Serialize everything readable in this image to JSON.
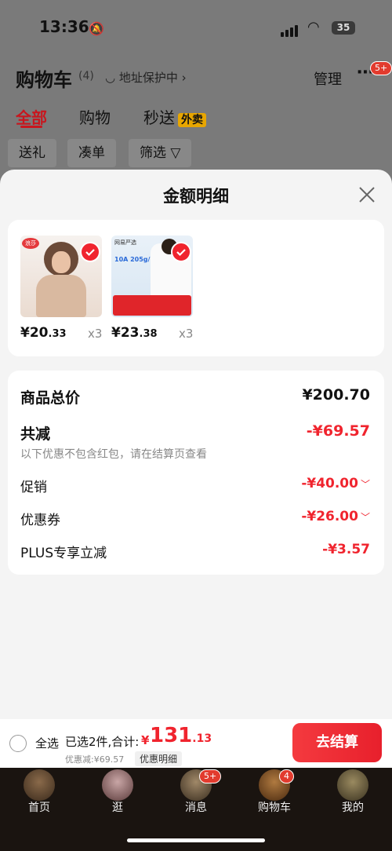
{
  "status_bar": {
    "time": "13:36",
    "battery": "35"
  },
  "background": {
    "title": "购物车",
    "count": "(4)",
    "address": "地址保护中",
    "manage": "管理",
    "more_badge": "5+",
    "tabs": [
      "全部",
      "购物",
      "秒送"
    ],
    "waimai": "外卖",
    "filters": [
      "送礼",
      "凑单",
      "筛选"
    ]
  },
  "sheet": {
    "title": "金额明细",
    "products": [
      {
        "brand": "浪莎",
        "price_int": "¥20",
        "price_dec": ".33",
        "qty": "x3"
      },
      {
        "brand": "网易严选",
        "price_int": "¥23",
        "price_dec": ".38",
        "qty": "x3"
      }
    ],
    "summary": {
      "total_label": "商品总价",
      "total_value": "¥200.70",
      "reduce_label": "共减",
      "reduce_value": "-¥69.57",
      "note": "以下优惠不包含红包，请在结算页查看",
      "promo_label": "促销",
      "promo_value": "-¥40.00",
      "coupon_label": "优惠券",
      "coupon_value": "-¥26.00",
      "plus_label": "PLUS专享立减",
      "plus_value": "-¥3.57"
    }
  },
  "checkout": {
    "select_all": "全选",
    "selected": "已选2件,合计:",
    "currency": "¥",
    "amount_int": "131",
    "amount_dec": ".13",
    "discount": "优惠减:¥69.57",
    "detail": "优惠明细",
    "pay": "去结算"
  },
  "tabbar": {
    "items": [
      "首页",
      "逛",
      "消息",
      "购物车",
      "我的"
    ],
    "message_badge": "5+",
    "cart_badge": "4"
  },
  "colors": {
    "accent": "#f0242e",
    "sheet_bg": "#f4f4f4"
  }
}
